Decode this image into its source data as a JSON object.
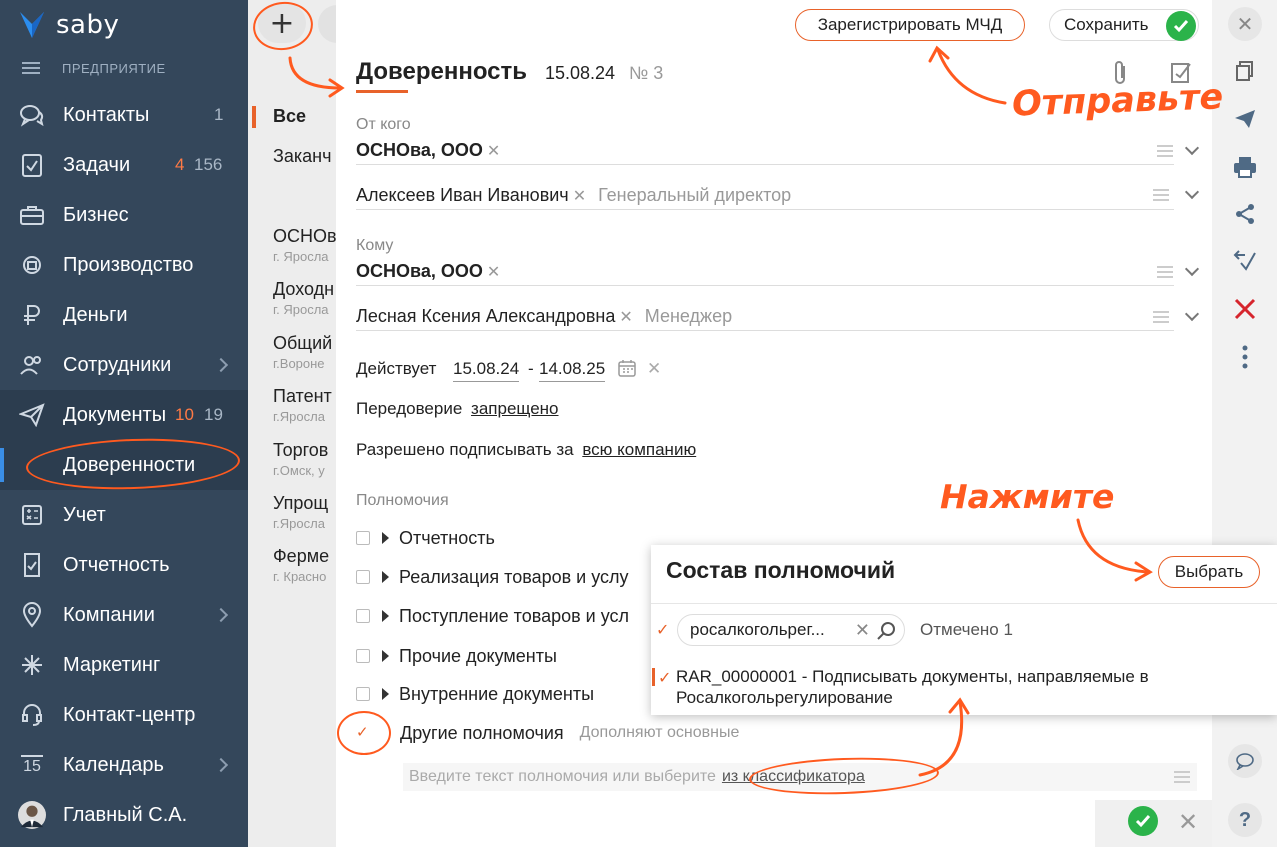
{
  "sidebar": {
    "logo_text": "saby",
    "company_label": "ПРЕДПРИЯТИЕ",
    "items": [
      {
        "label": "Контакты",
        "count": "1"
      },
      {
        "label": "Задачи",
        "count_red": "4",
        "count": "156"
      },
      {
        "label": "Бизнес"
      },
      {
        "label": "Производство"
      },
      {
        "label": "Деньги"
      },
      {
        "label": "Сотрудники"
      },
      {
        "label": "Документы",
        "count_red": "10",
        "count": "19"
      },
      {
        "label": "Доверенности"
      },
      {
        "label": "Учет"
      },
      {
        "label": "Отчетность"
      },
      {
        "label": "Компании"
      },
      {
        "label": "Маркетинг"
      },
      {
        "label": "Контакт-центр"
      },
      {
        "label": "Календарь",
        "icon_text": "15"
      },
      {
        "label": "Главный С.А."
      }
    ]
  },
  "list": {
    "filters": [
      "Все",
      "Заканч"
    ],
    "rows": [
      {
        "title": "ОСНОв",
        "sub": "г. Яросла"
      },
      {
        "title": "Доходн",
        "sub": "г. Яросла"
      },
      {
        "title": "Общий",
        "sub": "г.Вороне"
      },
      {
        "title": "Патент",
        "sub": "г.Яросла"
      },
      {
        "title": "Торгов",
        "sub": "г.Омск, у"
      },
      {
        "title": "Упрощ",
        "sub": "г.Яросла"
      },
      {
        "title": "Ферме",
        "sub": "г. Красно"
      }
    ]
  },
  "header": {
    "title": "Доверенность",
    "date": "15.08.24",
    "number": "№ 3",
    "register_button": "Зарегистрировать МЧД",
    "save_button": "Сохранить"
  },
  "form": {
    "from_label": "От кого",
    "from_org": "ОСНОва, ООО",
    "from_person": "Алексеев Иван Иванович",
    "from_position": "Генеральный директор",
    "to_label": "Кому",
    "to_org": "ОСНОва, ООО",
    "to_person": "Лесная Ксения Александровна",
    "to_position": "Менеджер",
    "valid_label": "Действует",
    "valid_from": "15.08.24",
    "valid_dash": "-",
    "valid_to": "14.08.25",
    "redelegation_label": "Передоверие",
    "redelegation_value": "запрещено",
    "sign_label": "Разрешено подписывать за",
    "sign_value": "всю компанию",
    "powers_label": "Полномочия",
    "powers": [
      "Отчетность",
      "Реализация товаров и услу",
      "Поступление товаров и усл",
      "Прочие документы",
      "Внутренние документы"
    ],
    "other_powers": "Другие полномочия",
    "other_powers_hint": "Дополняют основные",
    "input_placeholder": "Введите текст полномочия или выберите",
    "input_link": "из классификатора"
  },
  "popup": {
    "title": "Состав полномочий",
    "choose_button": "Выбрать",
    "search_value": "росалкогольрег...",
    "marked": "Отмечено 1",
    "item_line1": "RAR_00000001 - Подписывать документы, направляемые в",
    "item_line2": "Росалкогольрегулирование"
  },
  "annotations": {
    "send": "Отправьте",
    "press": "Нажмите"
  },
  "colors": {
    "sidebar_bg": "#34475b",
    "accent": "#e8622a",
    "annotation": "#ff5a1f",
    "success": "#2bb34a"
  }
}
